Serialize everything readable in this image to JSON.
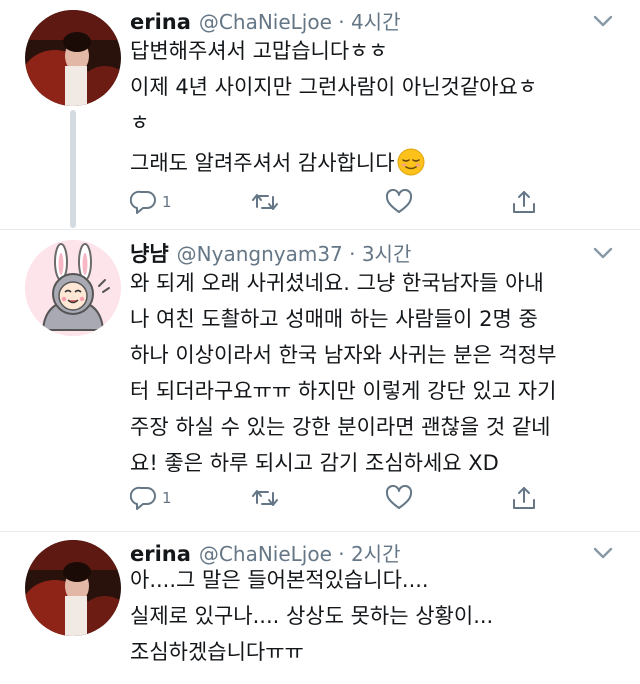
{
  "tweets": [
    {
      "name": "erina",
      "handle_time": "@ChaNieLjoe · 4시간",
      "lines": [
        "답변해주셔서 고맙습니다ㅎㅎ",
        "이제 4년 사이지만 그런사람이 아닌것같아요ㅎ",
        "ㅎ",
        "그래도 알려주셔서 감사합니다"
      ],
      "emoji": "relieved-face-emoji",
      "reply_count": "1"
    },
    {
      "name": "냥냠",
      "handle_time": "@Nyangnyam37 · 3시간",
      "lines": [
        "와 되게 오래 사귀셨네요. 그냥 한국남자들 아내",
        "나 여친 도촬하고 성매매 하는 사람들이 2명 중",
        "하나 이상이라서 한국 남자와 사귀는 분은 걱정부",
        "터 되더라구요ㅠㅠ 하지만 이렇게 강단 있고 자기",
        "주장 하실 수 있는 강한 분이라면 괜찮을 것 같네",
        "요! 좋은 하루 되시고 감기 조심하세요 XD"
      ],
      "reply_count": "1"
    },
    {
      "name": "erina",
      "handle_time": "@ChaNieLjoe · 2시간",
      "lines": [
        "아....그 말은 들어본적있습니다....",
        "실제로 있구나.... 상상도 못하는 상황이...",
        "조심하겠습니다ㅠㅠ"
      ]
    }
  ],
  "icons": {
    "reply": "reply-icon",
    "retweet": "retweet-icon",
    "like": "heart-icon",
    "share": "share-icon",
    "caret": "chevron-down-icon"
  },
  "colors": {
    "text": "#14171a",
    "secondary": "#657786",
    "thread_line": "#d4dbe1"
  }
}
